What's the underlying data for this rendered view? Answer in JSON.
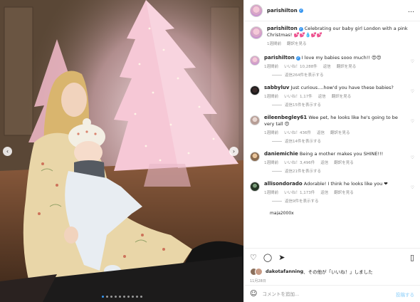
{
  "header": {
    "username": "parishilton",
    "verified_mark": "✓",
    "more_icon": "…"
  },
  "caption": {
    "username": "parishilton",
    "text": "Celebrating our baby girl London with a pink Christmas! 💕💕💧💕💕",
    "time": "1週間前",
    "translate": "翻訳を見る"
  },
  "comments": [
    {
      "username": "parishilton",
      "verified": true,
      "text": "I love my babies sooo much!! 😍😍",
      "time": "1週間前",
      "likes": "いいね！10,288件",
      "reply": "返信",
      "translate": "翻訳を見る",
      "replies": "返信264件を表示する"
    },
    {
      "username": "sabbyluv",
      "verified": false,
      "text": "Just curious....how'd you have these babies?",
      "time": "1週間前",
      "likes": "いいね！1,17件",
      "reply": "返信",
      "translate": "翻訳を見る",
      "replies": "返信15件を表示する"
    },
    {
      "username": "eileenbegley61",
      "verified": false,
      "text": "Wee pet, he looks like he's going to be very tall 😍",
      "time": "1週間前",
      "likes": "いいね！436件",
      "reply": "返信",
      "translate": "翻訳を見る",
      "replies": "返信14件を表示する"
    },
    {
      "username": "daniemichie",
      "verified": false,
      "text": "Being a mother makes you SHINE!!!",
      "time": "1週間前",
      "likes": "いいね！3,496件",
      "reply": "返信",
      "translate": "翻訳を見る",
      "replies": "返信21件を表示する"
    },
    {
      "username": "allisondorado",
      "verified": false,
      "text": "Adorable! I think he looks like you ❤",
      "time": "1週間前",
      "likes": "いいね！1,173件",
      "reply": "返信",
      "translate": "翻訳を見る",
      "replies": "返信9件を表示する"
    }
  ],
  "partial_comment": "maja2000x",
  "likes": {
    "user": "dakotafanning",
    "text": "、その他が「いいね！」しました"
  },
  "date": "11月28日",
  "add_comment": {
    "placeholder": "コメントを追加...",
    "post_label": "投稿する"
  },
  "carousel": {
    "prev": "‹",
    "next": "›",
    "slide_count": 10,
    "active_index": 0
  },
  "icons": {
    "like": "heart-icon",
    "comment": "comment-icon",
    "share": "share-icon",
    "save": "bookmark-icon",
    "emoji": "emoji-icon"
  },
  "colors": {
    "accent": "#3897f0",
    "tree_pink": "#f6c8d6"
  }
}
